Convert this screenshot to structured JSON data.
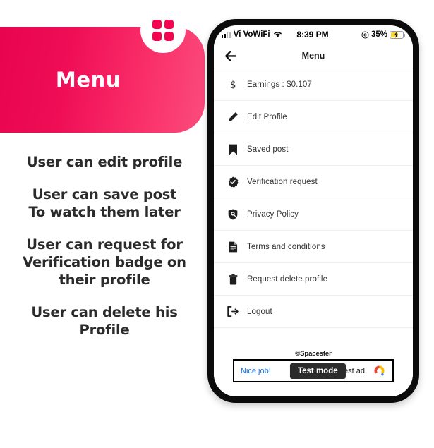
{
  "promo": {
    "title": "Menu",
    "logo_icon": "four-squares-grid-icon",
    "accent_color": "#f4054f",
    "gradient_from": "#e6004c",
    "gradient_to": "#fb4c7c",
    "features": [
      "User can edit profile",
      "User can save post\nTo watch them later",
      "User can request for\nVerification badge on\ntheir profile",
      "User can delete his\nProfile"
    ]
  },
  "phone": {
    "status_bar": {
      "carrier": "Vi VoWiFi",
      "signal_icon": "signal-bars-icon",
      "wifi_icon": "wifi-icon",
      "time": "8:39 PM",
      "location_icon": "location-services-icon",
      "battery_percent": "35%",
      "battery_icon": "battery-charging-icon"
    },
    "app_bar": {
      "back_icon": "back-arrow-icon",
      "title": "Menu"
    },
    "menu_items": [
      {
        "label": "Earnings : $0.107",
        "icon": "dollar-sign-icon"
      },
      {
        "label": "Edit Profile",
        "icon": "pencil-icon"
      },
      {
        "label": "Saved post",
        "icon": "bookmark-icon"
      },
      {
        "label": "Verification request",
        "icon": "verified-badge-icon"
      },
      {
        "label": "Privacy Policy",
        "icon": "shield-eye-icon"
      },
      {
        "label": "Terms and conditions",
        "icon": "document-icon"
      },
      {
        "label": "Request delete profile",
        "icon": "trash-icon"
      },
      {
        "label": "Logout",
        "icon": "logout-icon"
      }
    ],
    "ad": {
      "watermark": "©Spacester",
      "link_text": "Nice job!",
      "body_text": "test ad.",
      "badge_text": "Test mode",
      "logo_icon": "admob-logo-icon",
      "link_color": "#1a73e8"
    }
  }
}
